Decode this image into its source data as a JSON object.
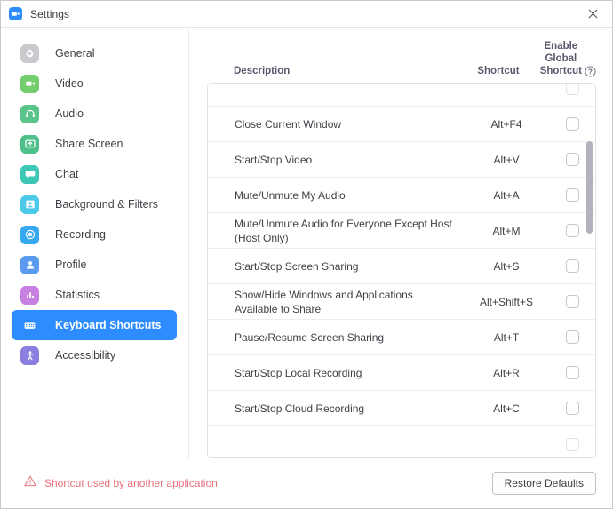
{
  "window": {
    "title": "Settings",
    "logo_icon": "zoom-logo-icon",
    "close_icon": "close-icon"
  },
  "sidebar": {
    "items": [
      {
        "label": "General",
        "icon": "gear-icon",
        "color": "#c9c9ce",
        "selected": false
      },
      {
        "label": "Video",
        "icon": "video-camera-icon",
        "color": "#74cd6f",
        "selected": false
      },
      {
        "label": "Audio",
        "icon": "headphones-icon",
        "color": "#5bc48a",
        "selected": false
      },
      {
        "label": "Share Screen",
        "icon": "share-screen-icon",
        "color": "#4fc08a",
        "selected": false
      },
      {
        "label": "Chat",
        "icon": "chat-bubble-icon",
        "color": "#3cc8b4",
        "selected": false
      },
      {
        "label": "Background & Filters",
        "icon": "person-frame-icon",
        "color": "#4cc8e8",
        "selected": false
      },
      {
        "label": "Recording",
        "icon": "record-circle-icon",
        "color": "#36a8f0",
        "selected": false
      },
      {
        "label": "Profile",
        "icon": "person-icon",
        "color": "#5a9bef",
        "selected": false
      },
      {
        "label": "Statistics",
        "icon": "bar-chart-icon",
        "color": "#c77fe0",
        "selected": false
      },
      {
        "label": "Keyboard Shortcuts",
        "icon": "keyboard-icon",
        "color": "#2d8cff",
        "selected": true
      },
      {
        "label": "Accessibility",
        "icon": "accessibility-icon",
        "color": "#8a7fe0",
        "selected": false
      }
    ],
    "selected": "Keyboard Shortcuts"
  },
  "table": {
    "headers": {
      "description": "Description",
      "shortcut": "Shortcut",
      "enable_global_1": "Enable",
      "enable_global_2": "Global",
      "enable_global_3": "Shortcut",
      "help_icon": "help-circle-icon"
    },
    "rows": [
      {
        "description": "",
        "shortcut": "",
        "enabled": false,
        "partial": "top"
      },
      {
        "description": "Close Current Window",
        "shortcut": "Alt+F4",
        "enabled": false
      },
      {
        "description": "Start/Stop Video",
        "shortcut": "Alt+V",
        "enabled": false
      },
      {
        "description": "Mute/Unmute My Audio",
        "shortcut": "Alt+A",
        "enabled": false
      },
      {
        "description": "Mute/Unmute Audio for Everyone Except Host (Host Only)",
        "shortcut": "Alt+M",
        "enabled": false
      },
      {
        "description": "Start/Stop Screen Sharing",
        "shortcut": "Alt+S",
        "enabled": false
      },
      {
        "description": "Show/Hide Windows and Applications Available to Share",
        "shortcut": "Alt+Shift+S",
        "enabled": false
      },
      {
        "description": "Pause/Resume Screen Sharing",
        "shortcut": "Alt+T",
        "enabled": false
      },
      {
        "description": "Start/Stop Local Recording",
        "shortcut": "Alt+R",
        "enabled": false
      },
      {
        "description": "Start/Stop Cloud Recording",
        "shortcut": "Alt+C",
        "enabled": false
      },
      {
        "description": "",
        "shortcut": "",
        "enabled": false,
        "partial": "bottom"
      }
    ],
    "scrollbar": {
      "thumb_top_pct": 15,
      "thumb_height_pct": 25
    }
  },
  "footer": {
    "warning_icon": "warning-triangle-icon",
    "warning_text": "Shortcut used by another application",
    "restore_label": "Restore Defaults"
  },
  "colors": {
    "accent": "#2d8cff",
    "warning": "#e8707a",
    "text": "#3f3f46",
    "header_text": "#5a5a6e",
    "border": "#e0e0e0"
  }
}
